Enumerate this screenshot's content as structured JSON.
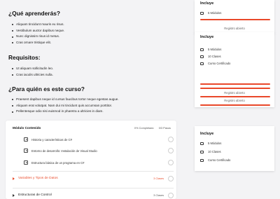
{
  "learn": {
    "title": "¿Qué aprenderás?",
    "items": [
      "Aliquam tincidunt mauris eu risus.",
      "Vestibulum auctor dapibus neque.",
      "Nunc dignissim risus id metus.",
      "Cras ornare tristique elit."
    ]
  },
  "requirements": {
    "title": "Requisitos:",
    "items": [
      "Ut aliquam sollicitudin leo.",
      "Cras iaculis ultricies nulla."
    ]
  },
  "audience": {
    "title": "¿Para quién es este curso?",
    "items": [
      "Praesent dapibus neque id cursus faucibus tortor neque egestas augue.",
      "Aliquam erat volutpat. Nam dui mi tincidunt quis accumsan porttitor.",
      "Pellentesque odio nisi euismod in pharetra a ultricies in diam."
    ]
  },
  "curriculum": {
    "module_title": "Módulo Contenido",
    "progress": "0% Completado",
    "steps": "0/3 Pasos",
    "lessons": [
      "Historia y características de C#",
      "Entorno de desarrollo: Instalación de Visual Studio",
      "Estructura básica de un programa en C#"
    ],
    "modules": [
      {
        "name": "Variables y Tipos de Datos",
        "count": "3 Clases",
        "accent": "#ea4c2c"
      },
      {
        "name": "Estructuras de Control",
        "count": "3 Clases",
        "accent": "#333333"
      }
    ]
  },
  "sidebar": {
    "panel1": {
      "title": "Incluye",
      "features": [
        "5 Módulos"
      ],
      "button": "Registro abierto"
    },
    "panel2": {
      "title": "Incluye",
      "features": [
        "5 Módulos",
        "10 Clases",
        "Curso Certificado"
      ],
      "buttons": [
        "Registro abierto",
        "Registro abierto"
      ]
    },
    "panel3": {
      "title": "Incluye",
      "features": [
        "5 Módulos",
        "10 Clases",
        "Curso Certificado"
      ]
    }
  },
  "colors": {
    "accent": "#e9482a"
  }
}
